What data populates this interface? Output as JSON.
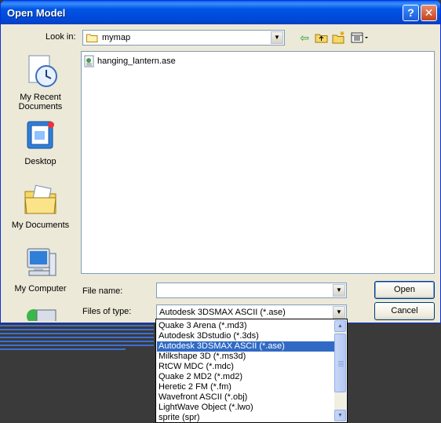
{
  "window": {
    "title": "Open Model",
    "help_glyph": "?",
    "close_glyph": "✕"
  },
  "lookin": {
    "label": "Look in:",
    "value": "mymap"
  },
  "toolbar": {
    "back_icon": "back-arrow-icon",
    "up_icon": "up-folder-icon",
    "new_folder_icon": "new-folder-icon",
    "view_menu_icon": "view-menu-icon"
  },
  "places": [
    {
      "label_line1": "My Recent",
      "label_line2": "Documents"
    },
    {
      "label_line1": "Desktop",
      "label_line2": ""
    },
    {
      "label_line1": "My Documents",
      "label_line2": ""
    },
    {
      "label_line1": "My Computer",
      "label_line2": ""
    }
  ],
  "files": [
    {
      "name": "hanging_lantern.ase"
    }
  ],
  "filename": {
    "label": "File name:",
    "value": ""
  },
  "filetype": {
    "label": "Files of type:",
    "value": "Autodesk 3DSMAX ASCII (*.ase)",
    "options": [
      "Quake 3 Arena (*.md3)",
      "Autodesk 3Dstudio (*.3ds)",
      "Autodesk 3DSMAX ASCII (*.ase)",
      "Milkshape 3D (*.ms3d)",
      "RtCW MDC (*.mdc)",
      "Quake 2 MD2 (*.md2)",
      "Heretic 2 FM (*.fm)",
      "Wavefront ASCII (*.obj)",
      "LightWave Object (*.lwo)",
      "sprite (spr)"
    ],
    "selected_index": 2
  },
  "buttons": {
    "open": "Open",
    "cancel": "Cancel"
  },
  "colors": {
    "titlebar": "#0055e5",
    "selection": "#316ac5",
    "dialog_bg": "#ece9d8"
  }
}
